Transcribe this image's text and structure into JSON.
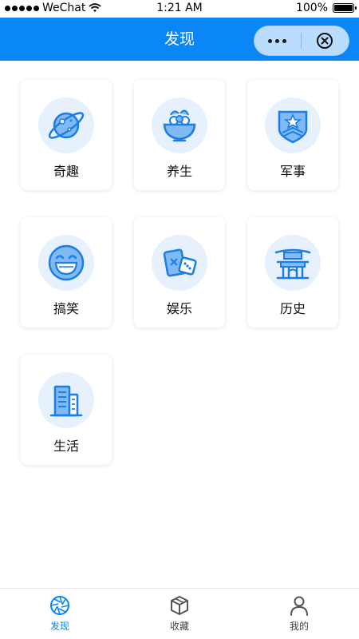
{
  "status_bar": {
    "carrier": "WeChat",
    "time": "1:21 AM",
    "battery": "100%"
  },
  "nav": {
    "title": "发现",
    "capsule": {
      "more_icon": "more-dots-icon",
      "close_icon": "close-circle-icon"
    }
  },
  "categories": [
    {
      "label": "奇趣",
      "icon": "planet-icon"
    },
    {
      "label": "养生",
      "icon": "salad-bowl-icon"
    },
    {
      "label": "军事",
      "icon": "military-badge-icon"
    },
    {
      "label": "搞笑",
      "icon": "laughing-face-icon"
    },
    {
      "label": "娱乐",
      "icon": "cards-dice-icon"
    },
    {
      "label": "历史",
      "icon": "pagoda-gate-icon"
    },
    {
      "label": "生活",
      "icon": "buildings-icon"
    }
  ],
  "tab_bar": {
    "active": "发现",
    "tabs": [
      {
        "label": "发现",
        "icon": "aperture-icon"
      },
      {
        "label": "收藏",
        "icon": "box-icon"
      },
      {
        "label": "我的",
        "icon": "user-icon"
      }
    ]
  },
  "colors": {
    "brand": "#0a86f7",
    "icon_bg": "#e6f1fd",
    "icon_stroke": "#1a7de8"
  }
}
